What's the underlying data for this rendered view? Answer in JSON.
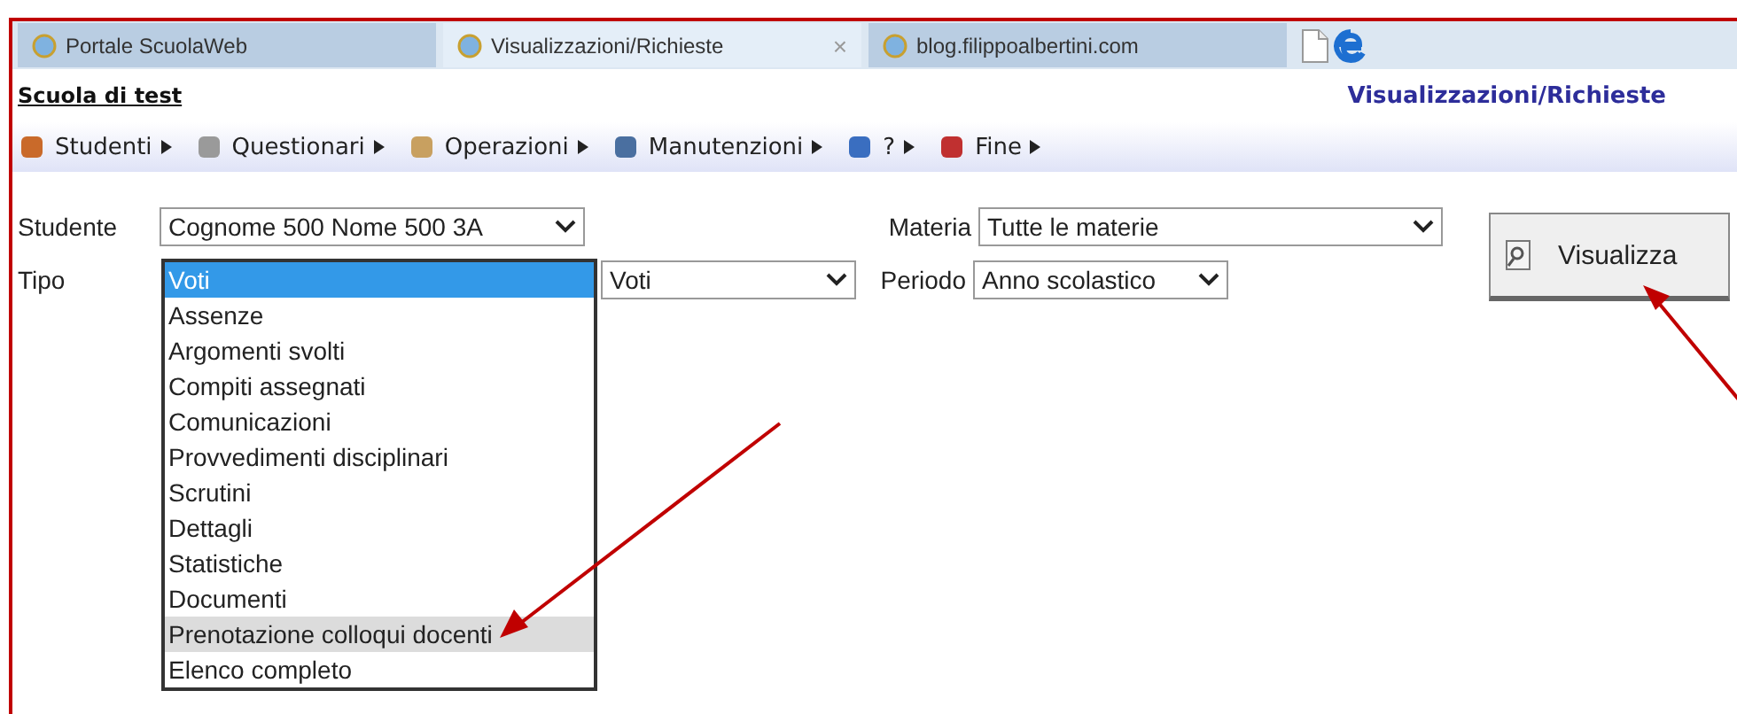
{
  "browser_tabs": [
    {
      "label": "Portale ScuolaWeb",
      "selected": false
    },
    {
      "label": "Visualizzazioni/Richieste",
      "selected": true,
      "close": "×"
    },
    {
      "label": "blog.filippoalbertini.com",
      "selected": false
    }
  ],
  "header": {
    "school": "Scuola di test",
    "page_title": "Visualizzazioni/Richieste"
  },
  "menu": [
    {
      "label": "Studenti",
      "kind": "students"
    },
    {
      "label": "Questionari",
      "kind": "survey"
    },
    {
      "label": "Operazioni",
      "kind": "operations"
    },
    {
      "label": "Manutenzioni",
      "kind": "maintenance"
    },
    {
      "label": "?",
      "kind": "help"
    },
    {
      "label": "Fine",
      "kind": "exit"
    }
  ],
  "form": {
    "studente": {
      "label": "Studente",
      "value": "Cognome 500 Nome 500 3A"
    },
    "tipo": {
      "label": "Tipo",
      "options": [
        {
          "label": "Voti",
          "selected": true,
          "hovered": false
        },
        {
          "label": "Assenze",
          "selected": false,
          "hovered": false
        },
        {
          "label": "Argomenti svolti",
          "selected": false,
          "hovered": false
        },
        {
          "label": "Compiti assegnati",
          "selected": false,
          "hovered": false
        },
        {
          "label": "Comunicazioni",
          "selected": false,
          "hovered": false
        },
        {
          "label": "Provvedimenti disciplinari",
          "selected": false,
          "hovered": false
        },
        {
          "label": "Scrutini",
          "selected": false,
          "hovered": false
        },
        {
          "label": "Dettagli",
          "selected": false,
          "hovered": false
        },
        {
          "label": "Statistiche",
          "selected": false,
          "hovered": false
        },
        {
          "label": "Documenti",
          "selected": false,
          "hovered": false
        },
        {
          "label": "Prenotazione colloqui docenti",
          "selected": false,
          "hovered": true
        },
        {
          "label": "Elenco completo",
          "selected": false,
          "hovered": false
        }
      ]
    },
    "subtipo": {
      "value": "Voti"
    },
    "materia": {
      "label": "Materia",
      "value": "Tutte le materie"
    },
    "periodo": {
      "label": "Periodo",
      "value": "Anno scolastico"
    },
    "button": "Visualizza"
  }
}
